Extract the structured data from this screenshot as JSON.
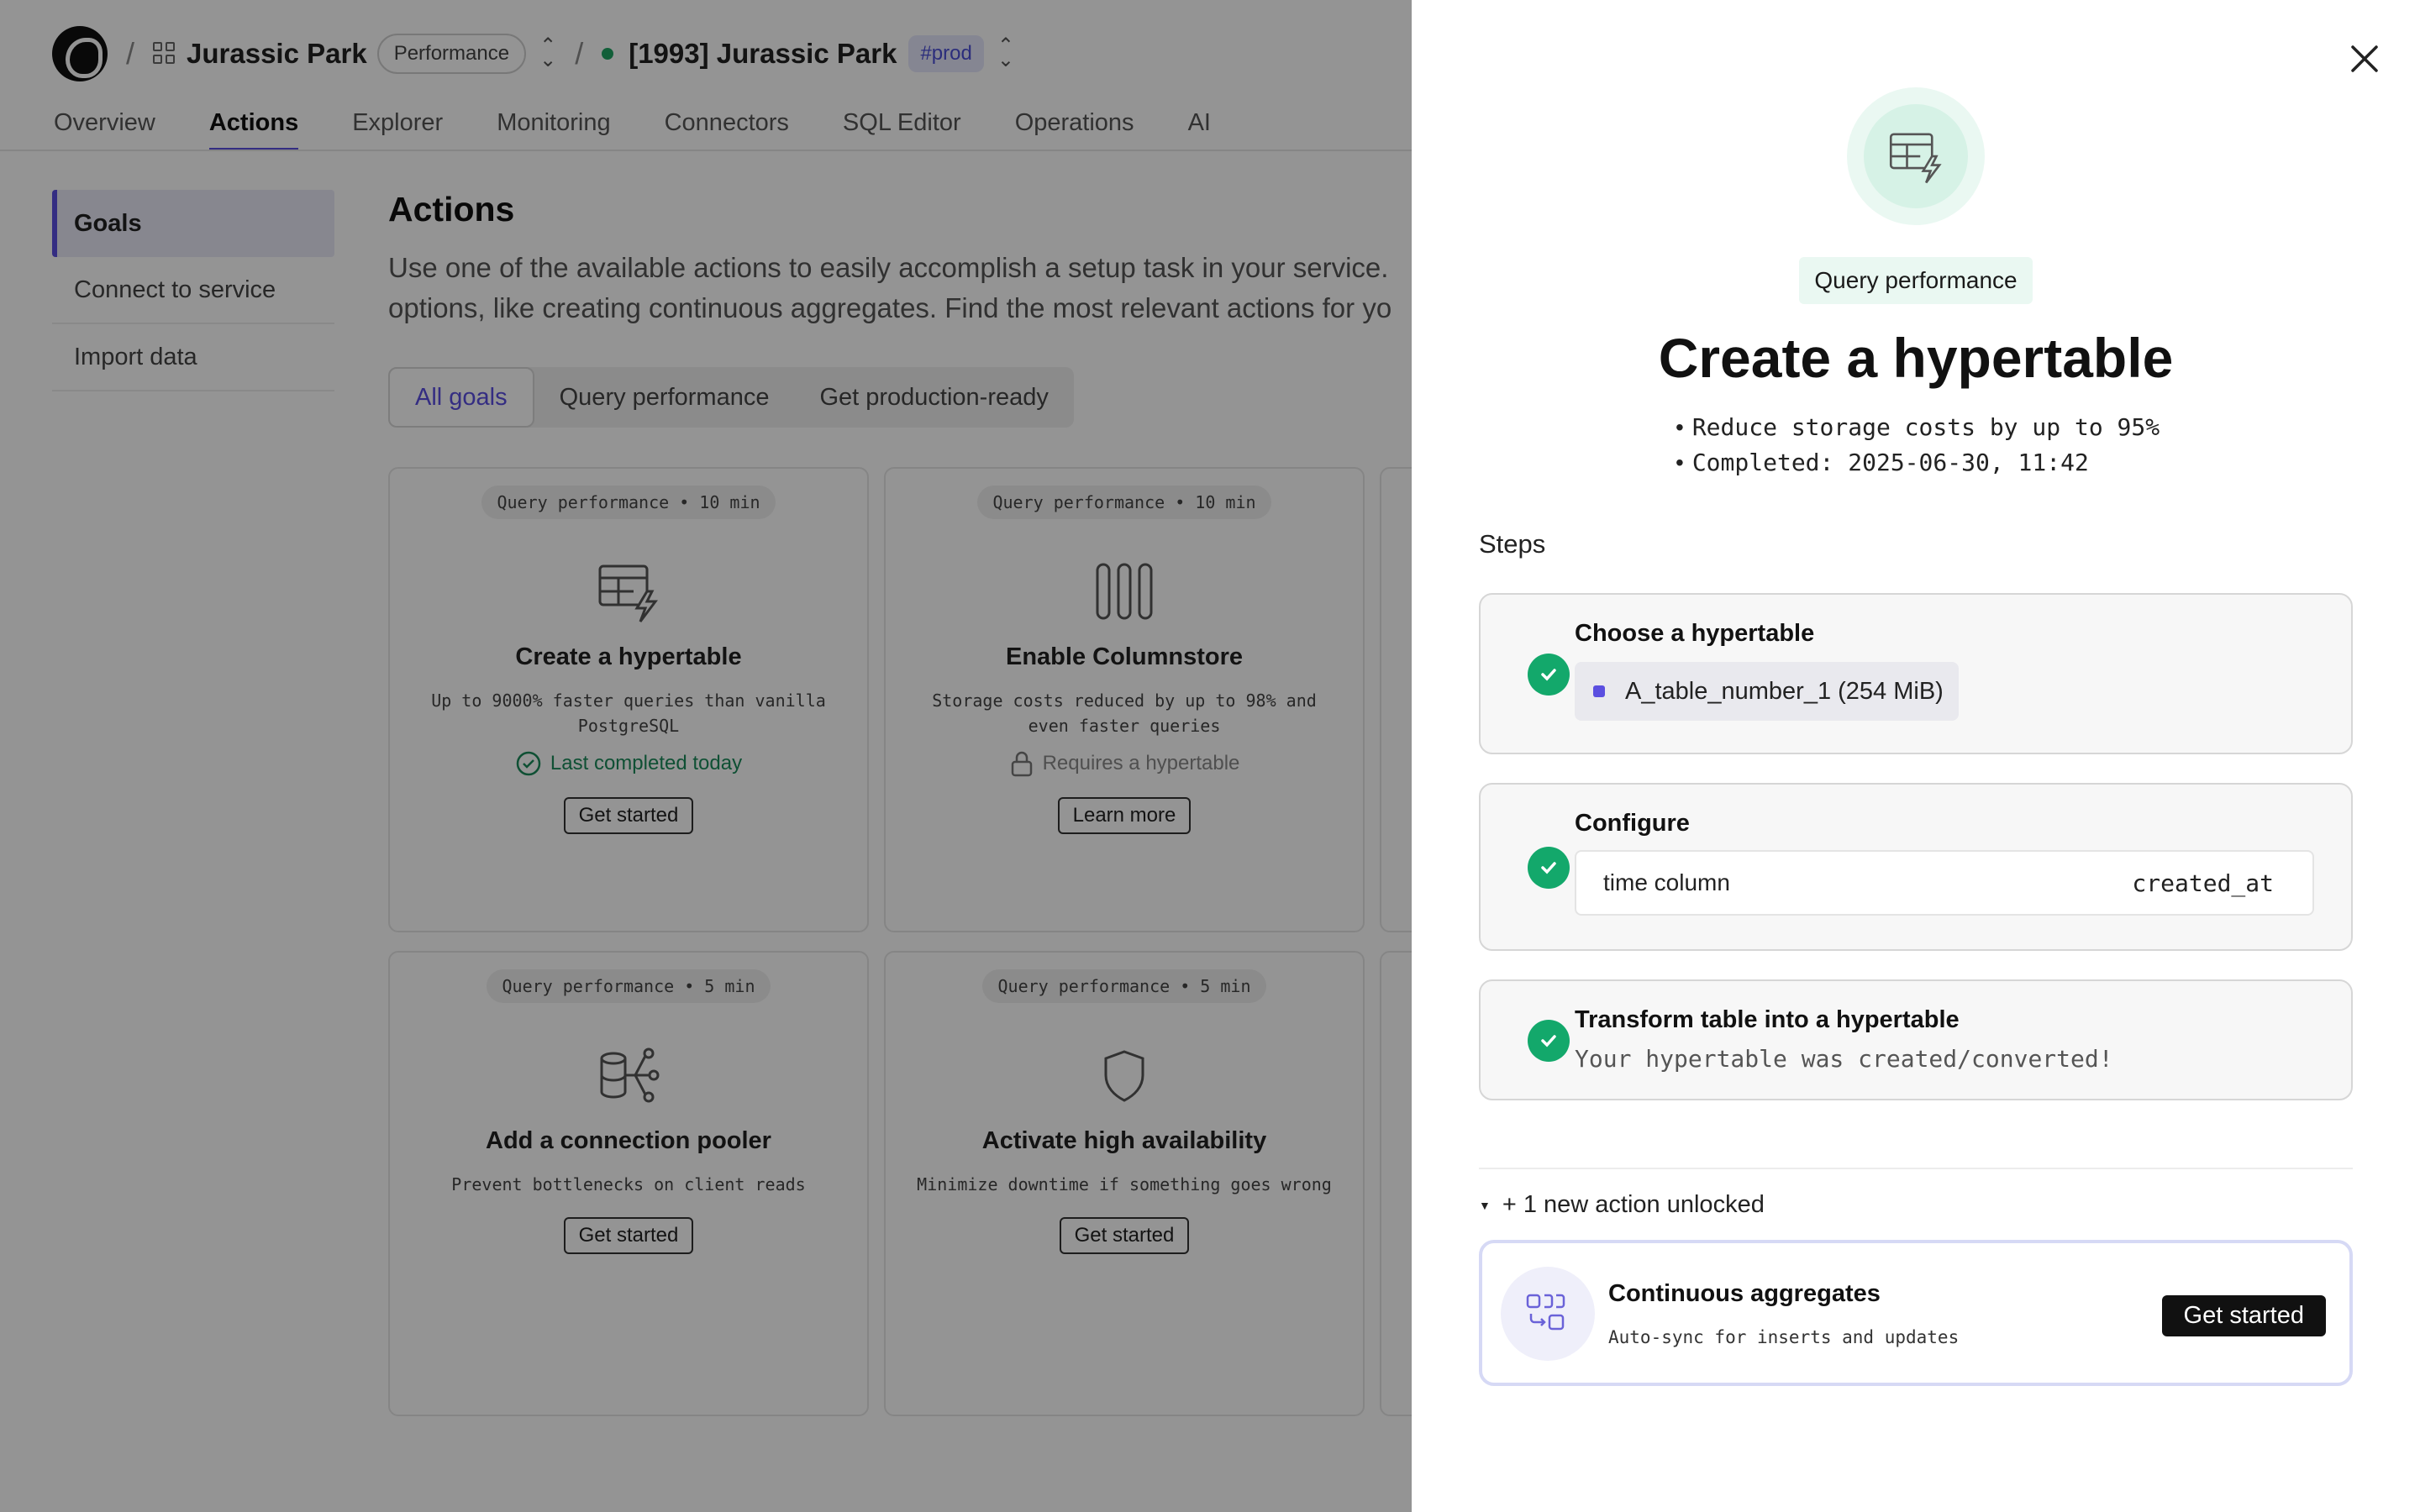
{
  "header": {
    "project_name": "Jurassic Park",
    "project_tier": "Performance",
    "service_name": "[1993] Jurassic Park",
    "service_env": "#prod",
    "separator": "/"
  },
  "nav": {
    "tabs": [
      {
        "label": "Overview"
      },
      {
        "label": "Actions",
        "active": true
      },
      {
        "label": "Explorer"
      },
      {
        "label": "Monitoring"
      },
      {
        "label": "Connectors"
      },
      {
        "label": "SQL Editor"
      },
      {
        "label": "Operations"
      },
      {
        "label": "AI"
      }
    ]
  },
  "sidebar": {
    "items": [
      {
        "label": "Goals",
        "active": true
      },
      {
        "label": "Connect to service"
      },
      {
        "label": "Import data"
      }
    ]
  },
  "main": {
    "title": "Actions",
    "desc_line1": "Use one of the available actions to easily accomplish a setup task in your service.",
    "desc_line2": "options, like creating continuous aggregates. Find the most relevant actions for yo",
    "filters": [
      "All goals",
      "Query performance",
      "Get production-ready"
    ]
  },
  "cards": [
    {
      "tag": "Query performance • 10 min",
      "icon": "table-lightning-icon",
      "title": "Create a hypertable",
      "sub": "Up to 9000% faster queries than vanilla PostgreSQL",
      "status": "Last completed today",
      "status_kind": "ok",
      "button": "Get started"
    },
    {
      "tag": "Query performance • 10 min",
      "icon": "columnstore-icon",
      "title": "Enable Columnstore",
      "sub": "Storage costs reduced by up to 98% and even faster queries",
      "status": "Requires a hypertable",
      "status_kind": "lock",
      "button": "Learn more"
    },
    {
      "tag": "Query performance • 5 min",
      "icon": "connection-pooler-icon",
      "title": "Add a connection pooler",
      "sub": "Prevent bottlenecks on client reads",
      "status": "",
      "status_kind": "",
      "button": "Get started"
    },
    {
      "tag": "Query performance • 5 min",
      "icon": "shield-icon",
      "title": "Activate high availability",
      "sub": "Minimize downtime if something goes wrong",
      "status": "",
      "status_kind": "",
      "button": "Get started"
    }
  ],
  "drawer": {
    "tag": "Query performance",
    "title": "Create a hypertable",
    "bullets": [
      "Reduce storage costs by up to 95%",
      "Completed: 2025-06-30, 11:42"
    ],
    "steps_label": "Steps",
    "steps": [
      {
        "title": "Choose a hypertable",
        "table": "A_table_number_1 (254 MiB)"
      },
      {
        "title": "Configure",
        "key": "time column",
        "value": "created_at"
      },
      {
        "title": "Transform table into a hypertable",
        "message": "Your hypertable was created/converted!"
      }
    ],
    "unlocked_label": "+ 1 new action unlocked",
    "unlocked_card": {
      "title": "Continuous aggregates",
      "sub": "Auto-sync for inserts and updates",
      "button": "Get started"
    }
  },
  "colors": {
    "accent": "#5b4fe0",
    "success": "#13a86b",
    "status_dot": "#1fa463",
    "overlay": "rgba(0,0,0,0.42)"
  }
}
